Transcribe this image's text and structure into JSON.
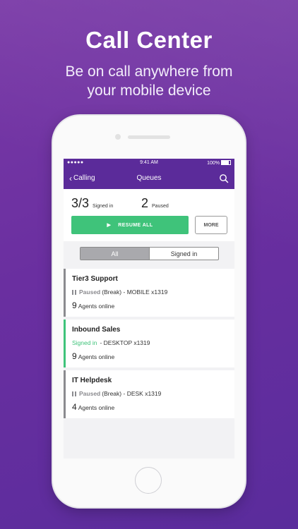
{
  "promo": {
    "title": "Call Center",
    "subtitle_line1": "Be on call anywhere from",
    "subtitle_line2": "your mobile device"
  },
  "statusbar": {
    "signal": "●●●●● ",
    "time": "9:41 AM",
    "battery": "100%"
  },
  "nav": {
    "back_label": "Calling",
    "title": "Queues",
    "search_icon": "search-icon"
  },
  "summary": {
    "signed_in_count": "3/3",
    "signed_in_label": "Signed in",
    "paused_count": "2",
    "paused_label": "Paused",
    "resume_label": "RESUME ALL",
    "more_label": "MORE"
  },
  "filter": {
    "tabs": [
      "All",
      "Signed in"
    ],
    "selected": "All"
  },
  "queues": [
    {
      "name": "Tier3 Support",
      "status": "Paused",
      "reason": "(Break)",
      "device": "- MOBILE x1319",
      "agents": "9",
      "agents_label": "Agents online"
    },
    {
      "name": "Inbound Sales",
      "status": "Signed in",
      "reason": "",
      "device": "- DESKTOP x1319",
      "agents": "9",
      "agents_label": "Agents online"
    },
    {
      "name": "IT Helpdesk",
      "status": "Paused",
      "reason": "(Break)",
      "device": "- DESK x1319",
      "agents": "4",
      "agents_label": "Agents online"
    }
  ],
  "colors": {
    "brand": "#5b2b9a",
    "signed_in": "#3fc37a",
    "paused": "#8b8b8f"
  }
}
